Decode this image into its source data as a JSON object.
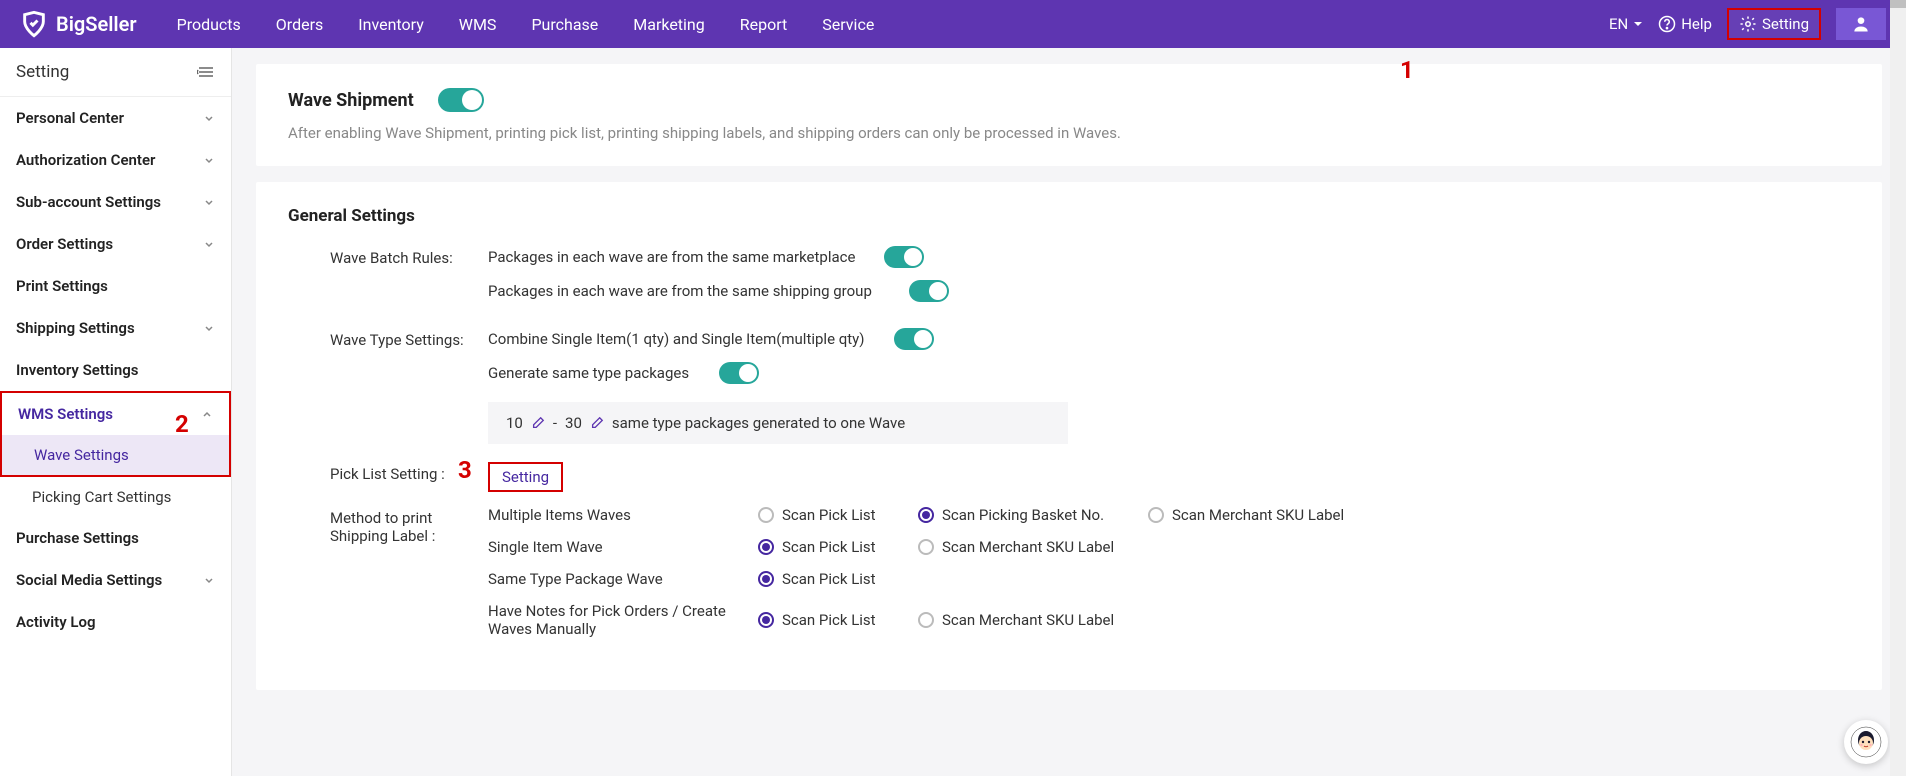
{
  "brand": "BigSeller",
  "nav": {
    "items": [
      "Products",
      "Orders",
      "Inventory",
      "WMS",
      "Purchase",
      "Marketing",
      "Report",
      "Service"
    ],
    "lang": "EN",
    "help": "Help",
    "setting": "Setting"
  },
  "annotations": {
    "a1": "1",
    "a2": "2",
    "a3": "3"
  },
  "sidebar": {
    "title": "Setting",
    "items": {
      "personal": "Personal Center",
      "auth": "Authorization Center",
      "subacct": "Sub-account Settings",
      "order": "Order Settings",
      "print": "Print Settings",
      "shipping": "Shipping Settings",
      "inventory": "Inventory Settings",
      "wms": "WMS Settings",
      "wave": "Wave Settings",
      "picking": "Picking Cart Settings",
      "purchase": "Purchase Settings",
      "social": "Social Media Settings",
      "activity": "Activity Log"
    }
  },
  "wave": {
    "title": "Wave Shipment",
    "desc": "After enabling Wave Shipment, printing pick list, printing shipping labels, and shipping orders can only be processed in Waves."
  },
  "general": {
    "title": "General Settings",
    "batch_label": "Wave Batch Rules:",
    "batch_opt1": "Packages in each wave are from the same marketplace",
    "batch_opt2": "Packages in each wave are from the same shipping group",
    "type_label": "Wave Type Settings:",
    "type_opt1": "Combine Single Item(1 qty) and Single Item(multiple qty)",
    "type_opt2": "Generate same type packages",
    "range": {
      "from": "10",
      "sep": "-",
      "to": "30",
      "suffix": "same type packages generated to one Wave"
    },
    "picklist_label": "Pick List Setting :",
    "picklist_link": "Setting",
    "method_label": "Method to print Shipping Label :",
    "rows": {
      "multi": {
        "label": "Multiple Items Waves",
        "o1": "Scan Pick List",
        "o2": "Scan Picking Basket No.",
        "o3": "Scan Merchant SKU Label"
      },
      "single": {
        "label": "Single Item Wave",
        "o1": "Scan Pick List",
        "o2": "Scan Merchant SKU Label"
      },
      "sametype": {
        "label": "Same Type Package Wave",
        "o1": "Scan Pick List"
      },
      "notes": {
        "label": "Have Notes for Pick Orders / Create Waves Manually",
        "o1": "Scan Pick List",
        "o2": "Scan Merchant SKU Label"
      }
    }
  }
}
